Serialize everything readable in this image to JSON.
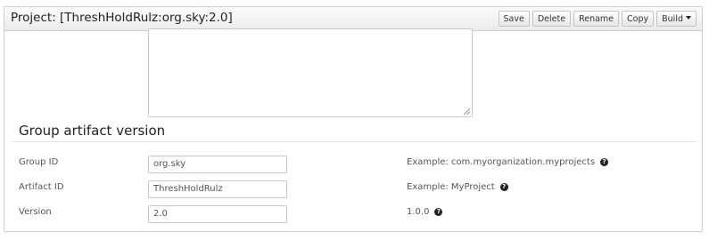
{
  "header": {
    "title": "Project: [ThreshHoldRulz:org.sky:2.0]",
    "buttons": {
      "save": "Save",
      "delete": "Delete",
      "rename": "Rename",
      "copy": "Copy",
      "build": "Build"
    }
  },
  "section": {
    "title": "Group artifact version"
  },
  "fields": {
    "group_id": {
      "label": "Group ID",
      "value": "org.sky",
      "hint": "Example: com.myorganization.myprojects"
    },
    "artifact_id": {
      "label": "Artifact ID",
      "value": "ThreshHoldRulz",
      "hint": "Example: MyProject"
    },
    "version": {
      "label": "Version",
      "value": "2.0",
      "hint": "1.0.0"
    }
  },
  "icons": {
    "help": "question-circle-icon",
    "build_caret": "caret-down-icon"
  }
}
